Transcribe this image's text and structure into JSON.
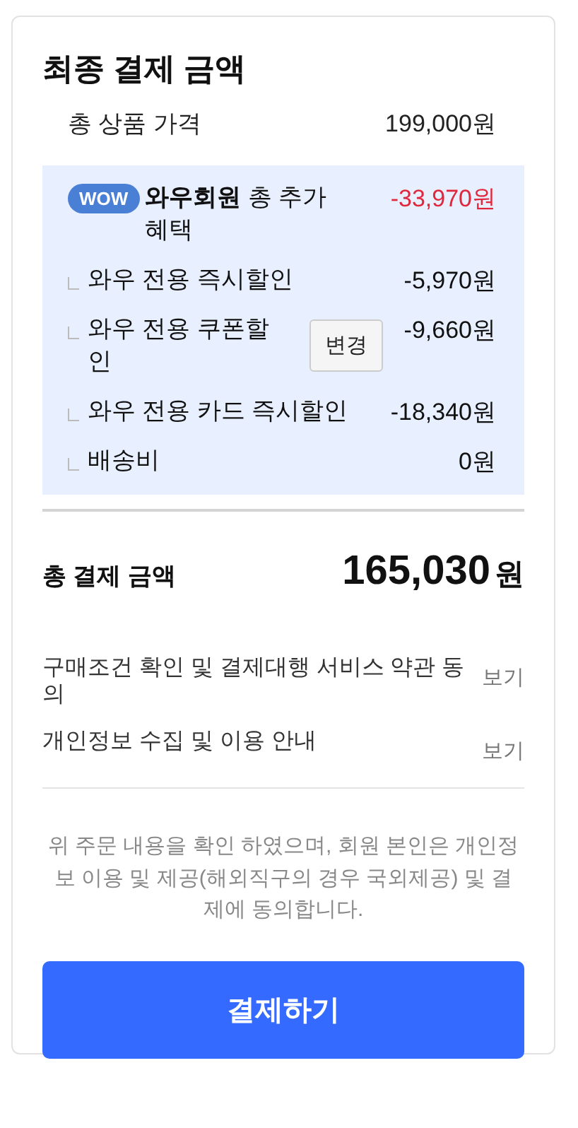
{
  "title": "최종 결제 금액",
  "subtotal": {
    "label": "총 상품 가격",
    "value": "199,000원"
  },
  "member_benefit": {
    "badge": "WOW",
    "text": "**와우회원** 총 추가 혜택",
    "value": "-33,970원",
    "items": [
      {
        "label": "와우 전용 즉시할인",
        "value": "-5,970원"
      },
      {
        "label": "와우 전용 쿠폰할인",
        "value": "-9,660원",
        "button": "변경"
      },
      {
        "label": "와우 전용 카드 즉시할인",
        "value": "-18,340원"
      },
      {
        "label": "배송비",
        "value": "0원"
      }
    ]
  },
  "total": {
    "label": "총 결제 금액",
    "amount": "165,030",
    "unit": "원"
  },
  "terms": [
    {
      "label": "구매조건 확인 및 결제대행 서비스 약관 동의",
      "link": "보기"
    },
    {
      "label": "개인정보 수집 및 이용 안내",
      "link": "보기"
    }
  ],
  "notice": "위 주문 내용을 확인 하였으며, 회원 본인은 개인정보 이용 및 제공(해외직구의 경우 국외제공) 및 결제에 동의합니다.",
  "pay_button": "결제하기"
}
